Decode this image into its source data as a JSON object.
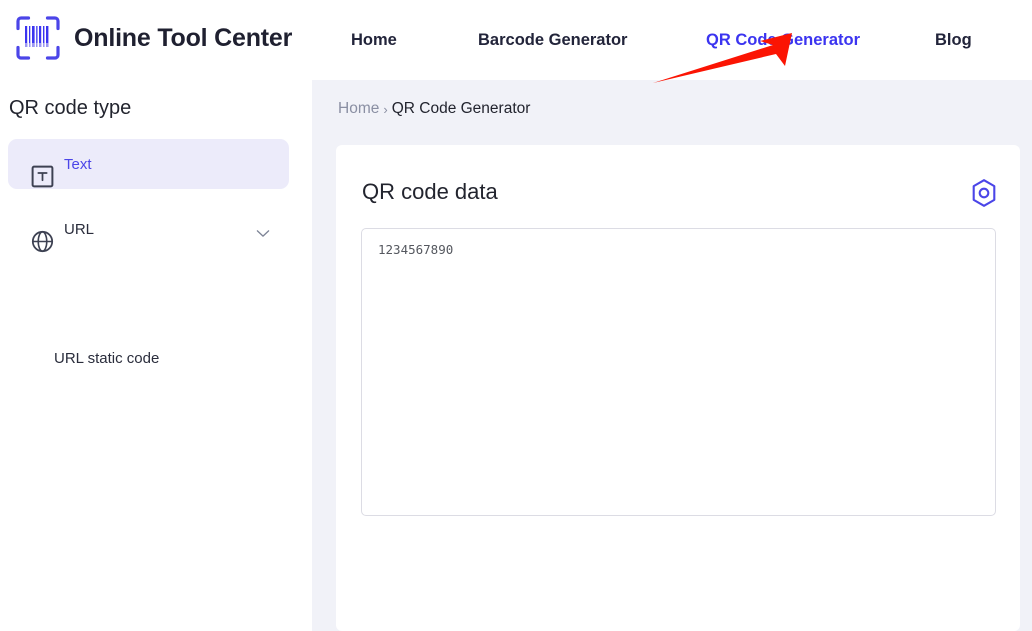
{
  "header": {
    "brand": {
      "icon": "barcode-scanner-icon",
      "name": "Online Tool Center"
    },
    "nav": [
      {
        "label": "Home",
        "active": false
      },
      {
        "label": "Barcode Generator",
        "active": false
      },
      {
        "label": "QR Code Generator",
        "active": true
      },
      {
        "label": "Blog",
        "active": false
      }
    ]
  },
  "sidebar": {
    "title": "QR code type",
    "items": [
      {
        "label": "Text",
        "icon": "text-box-icon",
        "selected": true,
        "expandable": false
      },
      {
        "label": "URL",
        "icon": "globe-icon",
        "selected": false,
        "expandable": true
      }
    ],
    "sub_items": [
      {
        "label": "URL static code"
      }
    ]
  },
  "breadcrumb": {
    "home": "Home",
    "separator": "›",
    "current": "QR Code Generator"
  },
  "card": {
    "title": "QR code data",
    "settings_icon": "hex-gear-icon",
    "textarea": {
      "value": "1234567890",
      "placeholder": "1234567890"
    }
  },
  "annotation": {
    "type": "arrow",
    "color": "#fb1403",
    "points_to": "QR Code Generator"
  },
  "colors": {
    "accent": "#3b34f0",
    "brand_text": "#1f2030",
    "content_bg": "#f1f2f8",
    "selected_bg": "#ecebfa",
    "selected_text": "#4b45e8",
    "muted_text": "#8a8fa3",
    "border": "#dcdce4",
    "annotation_red": "#fb1403"
  }
}
